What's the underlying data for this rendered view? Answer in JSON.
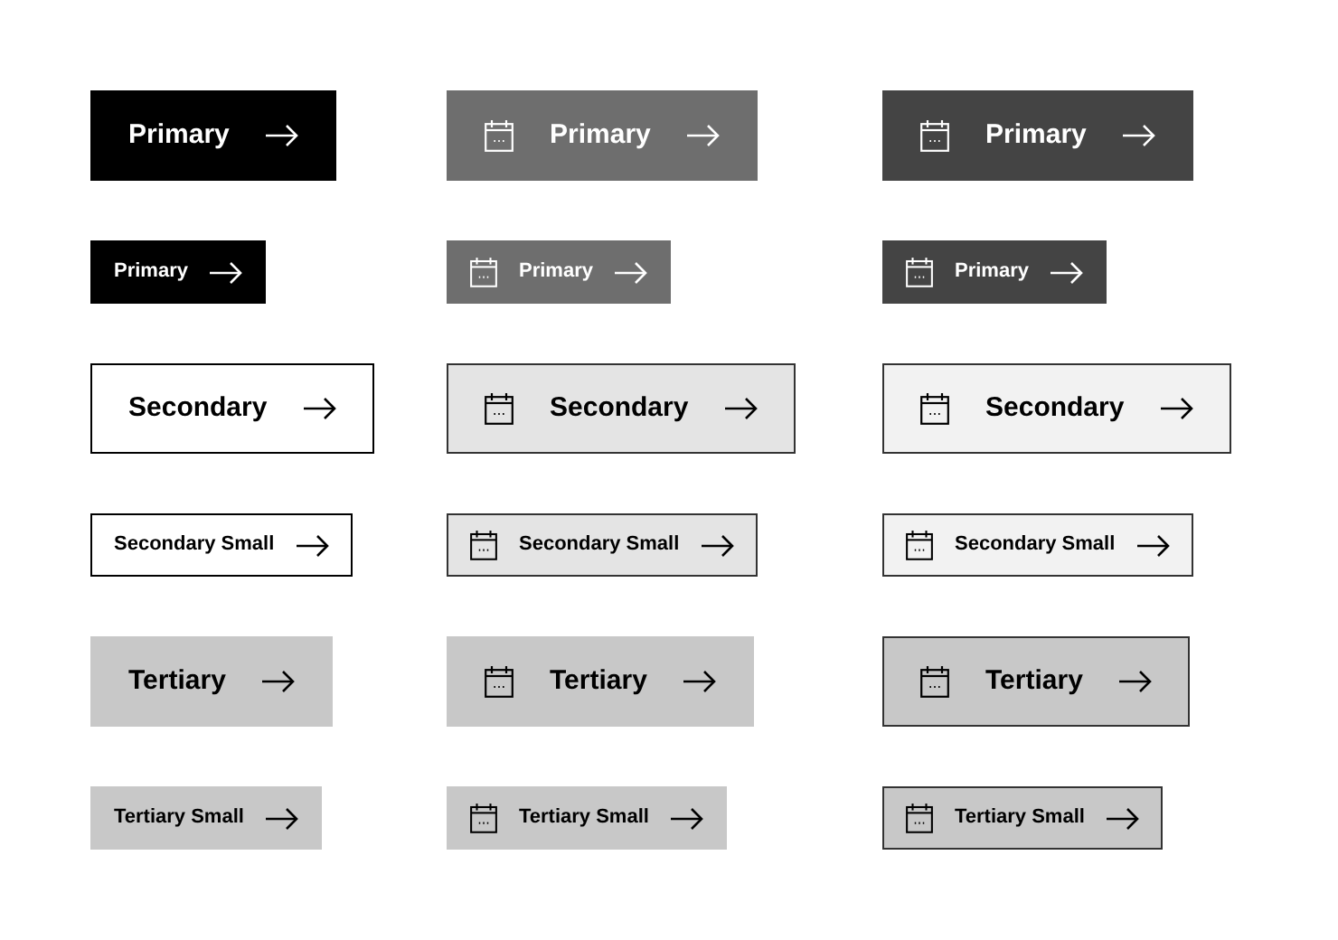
{
  "rows": [
    {
      "buttons": [
        {
          "label": "Primary",
          "kind": "primary",
          "small": false,
          "icon": false,
          "color": "#000000",
          "bordered": false
        },
        {
          "label": "Primary",
          "kind": "primary",
          "small": false,
          "icon": true,
          "color": "#6e6e6e",
          "bordered": false
        },
        {
          "label": "Primary",
          "kind": "primary",
          "small": false,
          "icon": true,
          "color": "#444444",
          "bordered": false
        }
      ]
    },
    {
      "buttons": [
        {
          "label": "Primary",
          "kind": "primary",
          "small": true,
          "icon": false,
          "color": "#000000",
          "bordered": false
        },
        {
          "label": "Primary",
          "kind": "primary",
          "small": true,
          "icon": true,
          "color": "#6e6e6e",
          "bordered": false
        },
        {
          "label": "Primary",
          "kind": "primary",
          "small": true,
          "icon": true,
          "color": "#444444",
          "bordered": false
        }
      ]
    },
    {
      "buttons": [
        {
          "label": "Secondary",
          "kind": "secondary",
          "small": false,
          "icon": false,
          "color": "#ffffff",
          "bordered": true
        },
        {
          "label": "Secondary",
          "kind": "secondary",
          "small": false,
          "icon": true,
          "color": "#e4e4e4",
          "bordered": true
        },
        {
          "label": "Secondary",
          "kind": "secondary",
          "small": false,
          "icon": true,
          "color": "#f2f2f2",
          "bordered": true
        }
      ]
    },
    {
      "buttons": [
        {
          "label": "Secondary Small",
          "kind": "secondary",
          "small": true,
          "icon": false,
          "color": "#ffffff",
          "bordered": true
        },
        {
          "label": "Secondary Small",
          "kind": "secondary",
          "small": true,
          "icon": true,
          "color": "#e4e4e4",
          "bordered": true
        },
        {
          "label": "Secondary Small",
          "kind": "secondary",
          "small": true,
          "icon": true,
          "color": "#f2f2f2",
          "bordered": true
        }
      ]
    },
    {
      "buttons": [
        {
          "label": "Tertiary",
          "kind": "tertiary",
          "small": false,
          "icon": false,
          "color": "#c8c8c8",
          "bordered": false
        },
        {
          "label": "Tertiary",
          "kind": "tertiary",
          "small": false,
          "icon": true,
          "color": "#c8c8c8",
          "bordered": false
        },
        {
          "label": "Tertiary",
          "kind": "tertiary",
          "small": false,
          "icon": true,
          "color": "#c8c8c8",
          "bordered": true
        }
      ]
    },
    {
      "buttons": [
        {
          "label": "Tertiary Small",
          "kind": "tertiary",
          "small": true,
          "icon": false,
          "color": "#c8c8c8",
          "bordered": false
        },
        {
          "label": "Tertiary Small",
          "kind": "tertiary",
          "small": true,
          "icon": true,
          "color": "#c8c8c8",
          "bordered": false
        },
        {
          "label": "Tertiary Small",
          "kind": "tertiary",
          "small": true,
          "icon": true,
          "color": "#c8c8c8",
          "bordered": true
        }
      ]
    }
  ]
}
